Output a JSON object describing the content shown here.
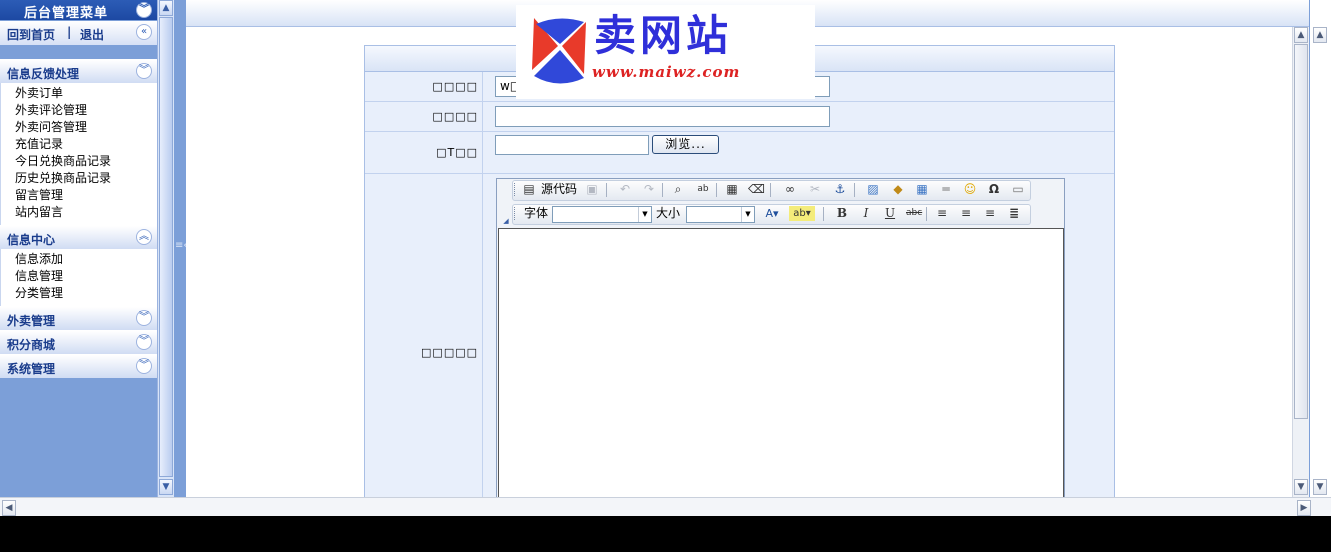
{
  "sidebar": {
    "header": "后台管理菜单",
    "links": {
      "home": "回到首页",
      "separator": "|",
      "logout": "退出"
    },
    "groups": [
      {
        "title": "信息反馈处理",
        "expanded": true,
        "items": [
          "外卖订单",
          "外卖评论管理",
          "外卖问答管理",
          "充值记录",
          "今日兑换商品记录",
          "历史兑换商品记录",
          "留言管理",
          "站内留言"
        ]
      },
      {
        "title": "信息中心",
        "expanded": true,
        "items": [
          "信息添加",
          "信息管理",
          "分类管理"
        ]
      },
      {
        "title": "外卖管理",
        "expanded": false,
        "items": []
      },
      {
        "title": "积分商城",
        "expanded": false,
        "items": []
      },
      {
        "title": "系统管理",
        "expanded": false,
        "items": []
      }
    ]
  },
  "form": {
    "row1": {
      "label": "□□□□",
      "value": "w□"
    },
    "row2": {
      "label": "□□□□",
      "value": ""
    },
    "row3": {
      "label": "□T□□",
      "value": "",
      "browse": "浏览..."
    },
    "row4": {
      "label": "□□□□□"
    }
  },
  "editor": {
    "source_label": "源代码",
    "font_label": "字体",
    "size_label": "大小",
    "font_value": "",
    "size_value": ""
  },
  "watermark": {
    "brand": "卖网站",
    "url": "www.maiwz.com"
  },
  "colors": {
    "sidebar_bg": "#7c9fd8",
    "header_blue": "#2c5cb6",
    "link_blue": "#1a3c8c",
    "logo_blue": "#2f2fd9",
    "logo_red": "#d22222"
  }
}
